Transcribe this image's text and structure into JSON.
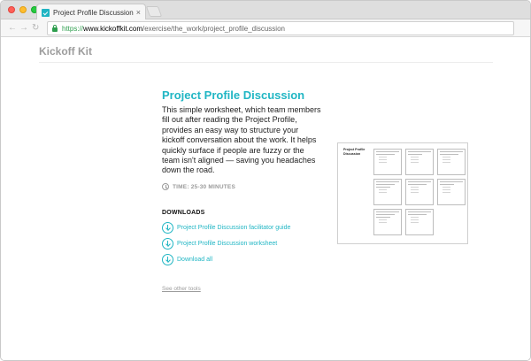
{
  "browser": {
    "tab_title": "Project Profile Discussion - Kic",
    "tab_close": "×",
    "url_scheme": "https://",
    "url_host": "www.kickoffkit.com",
    "url_path": "/exercise/the_work/project_profile_discussion"
  },
  "site": {
    "brand": "Kickoff Kit"
  },
  "exercise": {
    "title": "Project Profile Discussion",
    "description": "This simple worksheet, which team members fill out after reading the Project Profile, provides an easy way to structure your kickoff conversation about the work. It helps quickly surface if people are fuzzy or the team isn't aligned — saving you headaches down the road.",
    "time": "TIME: 25-30 MINUTES"
  },
  "downloads": {
    "heading": "DOWNLOADS",
    "items": [
      {
        "label": "Project Profile Discussion facilitator guide"
      },
      {
        "label": "Project Profile Discussion worksheet"
      },
      {
        "label": "Download all"
      }
    ]
  },
  "footer": {
    "other_tools": "See other tools"
  },
  "thumbnail": {
    "title": "Project Profile Discussion"
  },
  "colors": {
    "accent": "#21b6c4",
    "brand_gray": "#9c9c9c"
  }
}
